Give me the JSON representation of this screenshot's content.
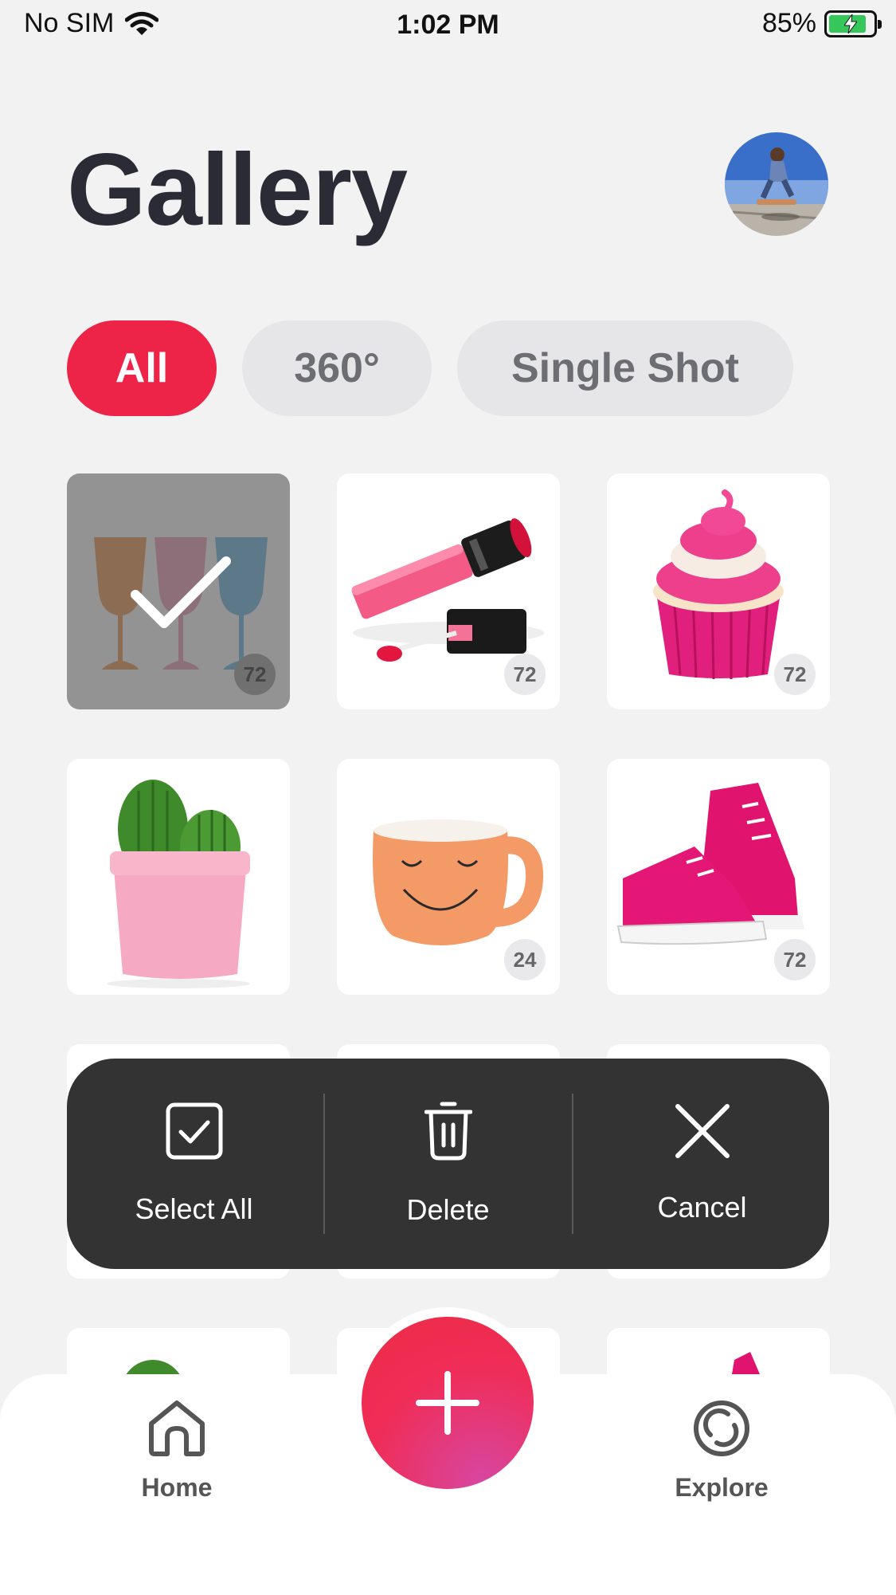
{
  "status_bar": {
    "carrier": "No SIM",
    "time": "1:02 PM",
    "battery": "85%"
  },
  "header": {
    "title": "Gallery"
  },
  "tabs": [
    {
      "label": "All",
      "active": true
    },
    {
      "label": "360°",
      "active": false
    },
    {
      "label": "Single Shot",
      "active": false
    }
  ],
  "grid": [
    {
      "subject": "wine glasses",
      "count": "72",
      "selected": true
    },
    {
      "subject": "lip gloss",
      "count": "72",
      "selected": false
    },
    {
      "subject": "cupcake",
      "count": "72",
      "selected": false
    },
    {
      "subject": "cactus",
      "count": "",
      "selected": false
    },
    {
      "subject": "mug",
      "count": "24",
      "selected": false
    },
    {
      "subject": "sneakers",
      "count": "72",
      "selected": false
    }
  ],
  "action_bar": {
    "select_all": "Select All",
    "delete": "Delete",
    "cancel": "Cancel"
  },
  "bottom_nav": {
    "home": "Home",
    "explore": "Explore"
  },
  "colors": {
    "accent": "#ed2347",
    "text": "#2b2b36",
    "background": "#f2f2f3"
  }
}
